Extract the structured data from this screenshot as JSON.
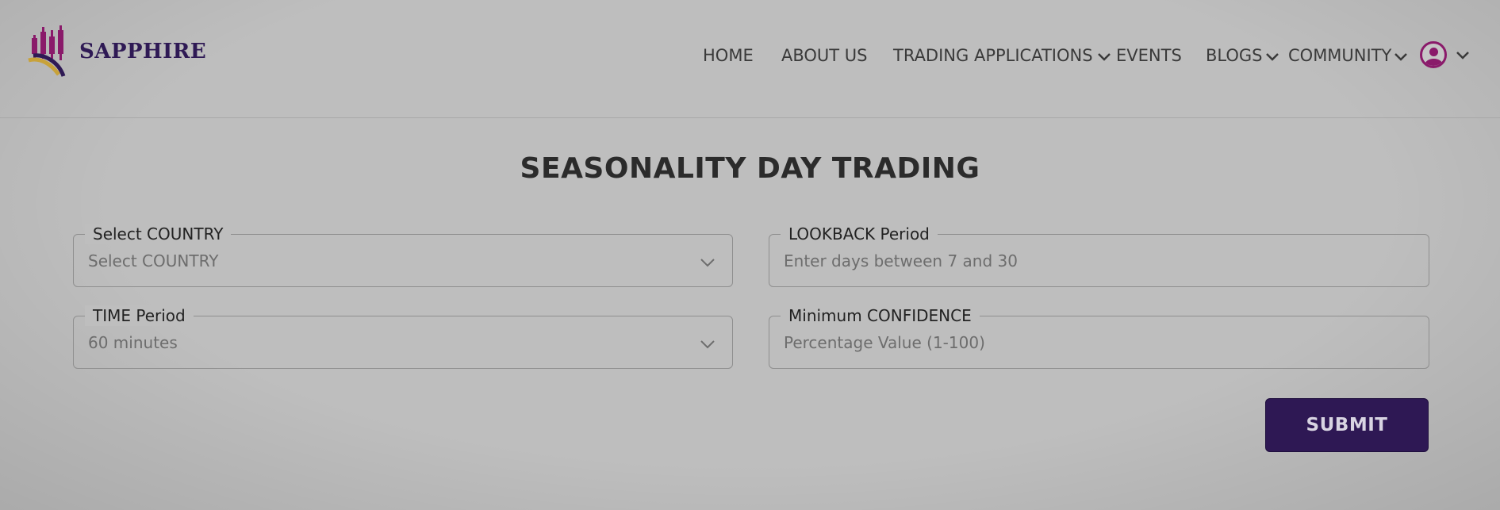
{
  "brand": {
    "name": "SAPPHIRE"
  },
  "nav": {
    "home": "HOME",
    "about": "ABOUT US",
    "trading": "TRADING APPLICATIONS",
    "events": "EVENTS",
    "blogs": "BLOGS",
    "community": "COMMUNITY"
  },
  "page": {
    "title": "SEASONALITY DAY TRADING"
  },
  "form": {
    "country": {
      "label": "Select COUNTRY",
      "value": "Select COUNTRY"
    },
    "lookback": {
      "label": "LOOKBACK Period",
      "placeholder": "Enter days between 7 and 30"
    },
    "time": {
      "label": "TIME Period",
      "value": "60 minutes"
    },
    "confidence": {
      "label": "Minimum CONFIDENCE",
      "placeholder": "Percentage Value (1-100)"
    },
    "submit": "SUBMIT"
  },
  "colors": {
    "brand": "#2f1a55",
    "accent": "#8a1a6a",
    "button": "#2e1854",
    "background": "#bebebe"
  },
  "icons": [
    "logo-icon",
    "chevron-down-icon",
    "user-avatar-icon"
  ]
}
